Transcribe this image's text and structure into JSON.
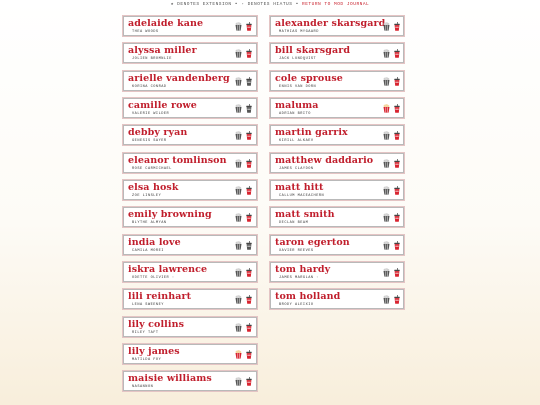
{
  "legend": {
    "ext_marker": "★",
    "ext_text": "DENOTES EXTENSION",
    "hiatus_marker": "◦",
    "hiatus_text": "DENOTES HIATUS",
    "separator": "•",
    "return_link": "RETURN TO MOD JOURNAL"
  },
  "colors": {
    "accent": "#c01e2c",
    "popcorn": "#d8232f",
    "tub": "#555555"
  },
  "left_column": [
    {
      "name": "adelaide kane",
      "role": "THEA WOODS",
      "popcorn_icon": "gray-popcorn-icon",
      "drink_icon": "red-drink-icon"
    },
    {
      "name": "alyssa miller",
      "role": "JOLIEN BROMNLIE",
      "popcorn_icon": "gray-popcorn-icon",
      "drink_icon": "red-drink-icon"
    },
    {
      "name": "arielle vandenberg",
      "role": "KORINA CONRAD",
      "popcorn_icon": "gray-popcorn-icon",
      "drink_icon": "gray-drink-icon"
    },
    {
      "name": "camille rowe",
      "role": "VALERIE WILDER",
      "popcorn_icon": "gray-popcorn-icon",
      "drink_icon": "gray-drink-icon"
    },
    {
      "name": "debby ryan",
      "role": "GENESIS SAYER",
      "popcorn_icon": "gray-popcorn-icon",
      "drink_icon": "red-drink-icon"
    },
    {
      "name": "eleanor tomlinson",
      "role": "ROSE CARMICHAEL",
      "popcorn_icon": "gray-popcorn-icon",
      "drink_icon": "red-drink-icon"
    },
    {
      "name": "elsa hosk",
      "role": "ZOE LINSLEY",
      "popcorn_icon": "gray-popcorn-icon",
      "drink_icon": "red-drink-icon"
    },
    {
      "name": "emily browning",
      "role": "BLYTHE ALMYAN",
      "popcorn_icon": "gray-popcorn-icon",
      "drink_icon": "red-drink-icon"
    },
    {
      "name": "india love",
      "role": "CAMILA MOREI",
      "popcorn_icon": "gray-popcorn-icon",
      "drink_icon": "gray-drink-icon"
    },
    {
      "name": "iskra lawrence",
      "role": "ODETTE OLIVIER ◦",
      "popcorn_icon": "gray-popcorn-icon",
      "drink_icon": "red-drink-icon"
    },
    {
      "name": "lili reinhart",
      "role": "LENA SWEENEY",
      "popcorn_icon": "gray-popcorn-icon",
      "drink_icon": "red-drink-icon"
    },
    {
      "name": "lily collins",
      "role": "RILEY TAFT",
      "popcorn_icon": "gray-popcorn-icon",
      "drink_icon": "red-drink-icon"
    },
    {
      "name": "lily james",
      "role": "MATILDA FOY",
      "popcorn_icon": "red-popcorn-icon",
      "drink_icon": "red-drink-icon"
    },
    {
      "name": "maisie williams",
      "role": "NASANNON",
      "popcorn_icon": "gray-popcorn-icon",
      "drink_icon": "red-drink-icon"
    }
  ],
  "right_column": [
    {
      "name": "alexander skarsgard",
      "role": "MATHIAS MYGAARD",
      "popcorn_icon": "gray-popcorn-icon",
      "drink_icon": "red-drink-icon"
    },
    {
      "name": "bill skarsgard",
      "role": "JACK LUNDQUIST",
      "popcorn_icon": "gray-popcorn-icon",
      "drink_icon": "red-drink-icon"
    },
    {
      "name": "cole sprouse",
      "role": "ENNIS VAN DORN",
      "popcorn_icon": "gray-popcorn-icon",
      "drink_icon": "red-drink-icon"
    },
    {
      "name": "maluma",
      "role": "ADRIAN BRITO",
      "popcorn_icon": "red-popcorn-icon",
      "drink_icon": "red-drink-icon"
    },
    {
      "name": "martin garrix",
      "role": "KIRILL ALKAEV",
      "popcorn_icon": "gray-popcorn-icon",
      "drink_icon": "red-drink-icon"
    },
    {
      "name": "matthew daddario",
      "role": "JAMES CLAYDON",
      "popcorn_icon": "gray-popcorn-icon",
      "drink_icon": "red-drink-icon"
    },
    {
      "name": "matt hitt",
      "role": "CALLUM MACEACHERN",
      "popcorn_icon": "gray-popcorn-icon",
      "drink_icon": "red-drink-icon"
    },
    {
      "name": "matt smith",
      "role": "DECLAN BEAM",
      "popcorn_icon": "gray-popcorn-icon",
      "drink_icon": "red-drink-icon"
    },
    {
      "name": "taron egerton",
      "role": "XAVIER REEVES",
      "popcorn_icon": "gray-popcorn-icon",
      "drink_icon": "red-drink-icon"
    },
    {
      "name": "tom hardy",
      "role": "JAMES MARGLAN ◦",
      "popcorn_icon": "gray-popcorn-icon",
      "drink_icon": "red-drink-icon"
    },
    {
      "name": "tom holland",
      "role": "BRODY ALEIXIO",
      "popcorn_icon": "gray-popcorn-icon",
      "drink_icon": "red-drink-icon"
    }
  ]
}
